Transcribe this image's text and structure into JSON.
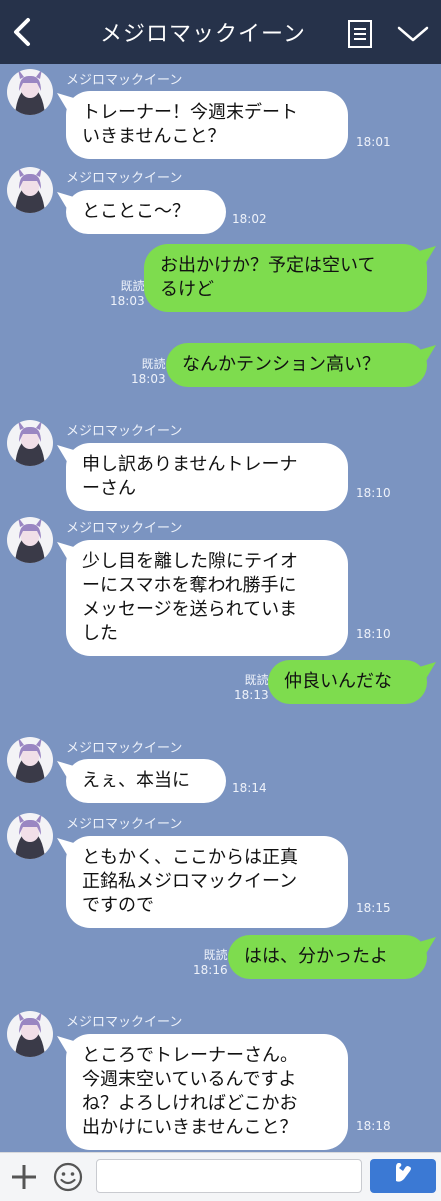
{
  "header": {
    "title": "メジロマックイーン"
  },
  "messages": [
    {
      "sender": "メジロマックイーン",
      "text": "トレーナー！今週末デート\nいきませんこと？",
      "time": "18:01"
    },
    {
      "sender": "メジロマックイーン",
      "text": "とことこ〜？",
      "time": "18:02"
    },
    {
      "read": "既読",
      "text": "お出かけか？予定は空いて\nるけど",
      "time": "18:03"
    },
    {
      "read": "既読",
      "text": "なんかテンション高い？",
      "time": "18:03"
    },
    {
      "sender": "メジロマックイーン",
      "text": "申し訳ありませんトレーナ\nーさん",
      "time": "18:10"
    },
    {
      "sender": "メジロマックイーン",
      "text": "少し目を離した隙にテイオ\nーにスマホを奪われ勝手に\nメッセージを送られていま\nした",
      "time": "18:10"
    },
    {
      "read": "既読",
      "text": "仲良いんだな",
      "time": "18:13"
    },
    {
      "sender": "メジロマックイーン",
      "text": "えぇ、本当に",
      "time": "18:14"
    },
    {
      "sender": "メジロマックイーン",
      "text": "ともかく、ここからは正真\n正銘私メジロマックイーン\nですので",
      "time": "18:15"
    },
    {
      "read": "既読",
      "text": "はは、分かったよ",
      "time": "18:16"
    },
    {
      "sender": "メジロマックイーン",
      "text": "ところでトレーナーさん。\n今週末空いているんですよ\nね？よろしければどこかお\n出かけにいきませんこと？",
      "time": "18:18"
    }
  ],
  "footer": {
    "input_value": ""
  },
  "icons": {
    "back": "back-icon",
    "memo": "memo-icon",
    "chevron": "chevron-down-icon",
    "plus": "plus-icon",
    "emoji": "emoji-icon",
    "send": "send-icon",
    "avatar": "avatar"
  },
  "colors": {
    "background": "#7b94c1",
    "header": "#26324a",
    "bubble_in": "#ffffff",
    "bubble_out": "#7edc4e",
    "send_button": "#3b79d4"
  }
}
